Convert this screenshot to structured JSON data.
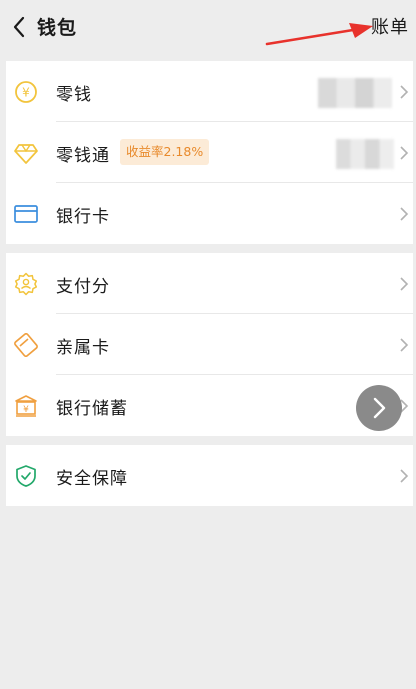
{
  "header": {
    "title": "钱包",
    "bill_label": "账单"
  },
  "colors": {
    "accent_gold": "#f2c43d",
    "accent_green": "#22a86a",
    "accent_blue": "#3b8ede",
    "badge_text": "#e88a2c",
    "arrow_red": "#e8322c"
  },
  "groups": [
    {
      "items": [
        {
          "label": "零钱",
          "icon": "yuan-coin-icon",
          "value_masked": true
        },
        {
          "label": "零钱通",
          "icon": "diamond-icon",
          "badge": "收益率2.18%",
          "value_masked": true
        },
        {
          "label": "银行卡",
          "icon": "bank-card-icon"
        }
      ]
    },
    {
      "items": [
        {
          "label": "支付分",
          "icon": "pay-score-icon"
        },
        {
          "label": "亲属卡",
          "icon": "family-card-icon"
        },
        {
          "label": "银行储蓄",
          "icon": "bank-savings-icon"
        }
      ]
    },
    {
      "items": [
        {
          "label": "安全保障",
          "icon": "shield-check-icon"
        }
      ]
    }
  ]
}
